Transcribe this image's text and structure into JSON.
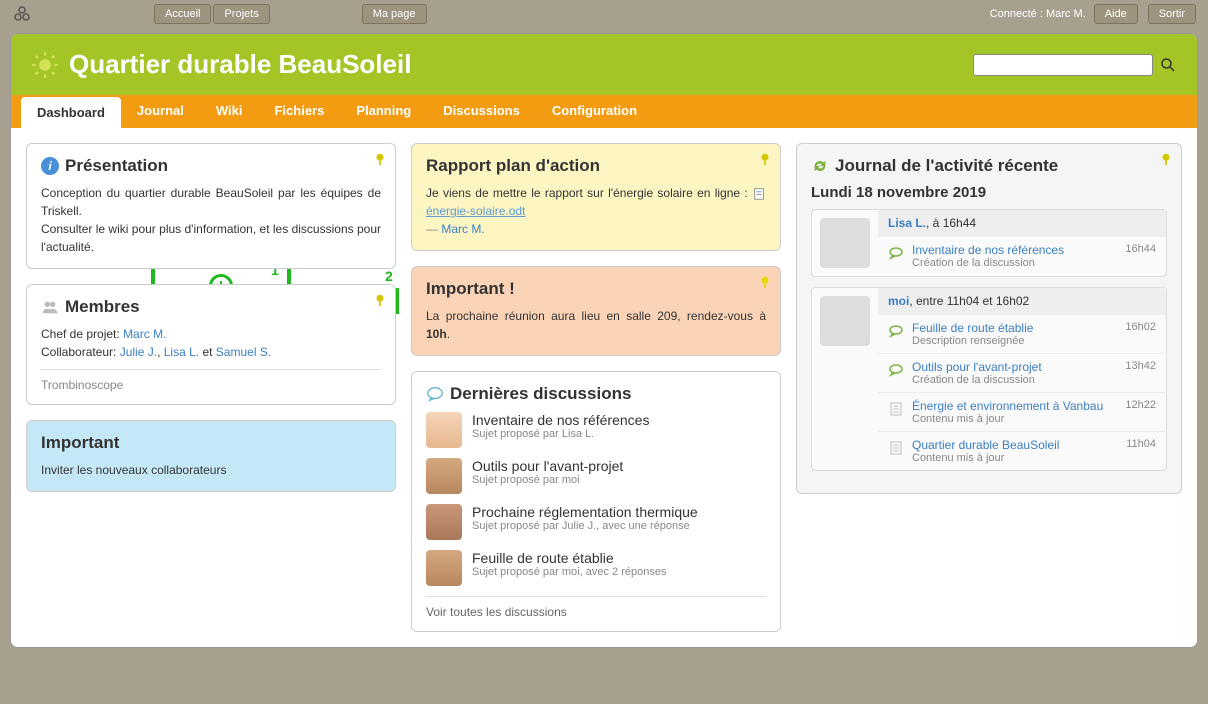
{
  "topbar": {
    "accueil": "Accueil",
    "projets": "Projets",
    "mapage": "Ma page",
    "connecte": "Connecté : Marc M.",
    "aide": "Aide",
    "sortir": "Sortir"
  },
  "header": {
    "title": "Quartier durable BeauSoleil",
    "search_placeholder": ""
  },
  "tabs": [
    "Dashboard",
    "Journal",
    "Wiki",
    "Fichiers",
    "Planning",
    "Discussions",
    "Configuration"
  ],
  "presentation": {
    "title": "Présentation",
    "body1": "Conception du quartier durable BeauSoleil par les équipes de Triskell.",
    "body2": "Consulter le wiki pour plus d'information, et les discussions pour l'actualité."
  },
  "membres": {
    "title": "Membres",
    "chef_label": "Chef de projet: ",
    "chef": "Marc M.",
    "collab_label": "Collaborateur: ",
    "c1": "Julie J.",
    "c2": "Lisa L.",
    "et": " et ",
    "c3": "Samuel S.",
    "trombi": "Trombinoscope"
  },
  "important_blue": {
    "title": "Important",
    "body": "Inviter les nouveaux collaborateurs"
  },
  "rapport": {
    "title": "Rapport plan d'action",
    "body": "Je viens de mettre le rapport sur l'énergie solaire en ligne : ",
    "file": "énergie-solaire.odt",
    "dash": "— ",
    "author": "Marc M."
  },
  "important_orange": {
    "title": "Important !",
    "body_pre": "La prochaine réunion aura lieu en salle 209, rendez-vous à ",
    "time": "10h",
    "body_post": "."
  },
  "discussions": {
    "title": "Dernières discussions",
    "items": [
      {
        "title": "Inventaire de nos références",
        "sub": "Sujet proposé par Lisa L.",
        "av": "a1"
      },
      {
        "title": "Outils pour l'avant-projet",
        "sub": "Sujet proposé par moi",
        "av": "a2"
      },
      {
        "title": "Prochaine réglementation thermique",
        "sub": "Sujet proposé par Julie J., avec une réponse",
        "av": "a3"
      },
      {
        "title": "Feuille de route établie",
        "sub": "Sujet proposé par moi, avec 2 réponses",
        "av": "a2"
      }
    ],
    "all": "Voir toutes les discussions"
  },
  "journal": {
    "title": "Journal de l'activité récente",
    "date": "Lundi 18 novembre 2019",
    "groups": [
      {
        "user": "Lisa L.",
        "user_suffix": ", à 16h44",
        "av": "a1",
        "rows": [
          {
            "title": "Inventaire de nos références",
            "sub": "Création de la discussion",
            "time": "16h44",
            "icon": "disc"
          }
        ]
      },
      {
        "user": "moi",
        "user_suffix": ", entre 11h04 et 16h02",
        "av": "a2",
        "rows": [
          {
            "title": "Feuille de route établie",
            "sub": "Description renseignée",
            "time": "16h02",
            "icon": "disc"
          },
          {
            "title": "Outils pour l'avant-projet",
            "sub": "Création de la discussion",
            "time": "13h42",
            "icon": "disc"
          },
          {
            "title": "Énergie et environnement à Vanbau",
            "sub": "Contenu mis à jour",
            "time": "12h22",
            "icon": "doc"
          },
          {
            "title": "Quartier durable BeauSoleil",
            "sub": "Contenu mis à jour",
            "time": "11h04",
            "icon": "doc"
          }
        ]
      }
    ]
  },
  "annotations": {
    "label1": "1",
    "label2": "2"
  }
}
